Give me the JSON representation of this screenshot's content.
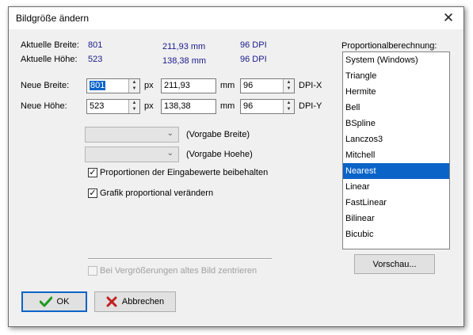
{
  "window": {
    "title": "Bildgröße ändern",
    "close_glyph": "✕"
  },
  "current": {
    "width_label": "Aktuelle Breite:",
    "height_label": "Aktuelle Höhe:",
    "width_px": "801",
    "height_px": "523",
    "width_mm": "211,93 mm",
    "height_mm": "138,38 mm",
    "dpi_x": "96 DPI",
    "dpi_y": "96 DPI"
  },
  "new": {
    "width_label": "Neue Breite:",
    "height_label": "Neue Höhe:",
    "width_px": "801",
    "height_px": "523",
    "px_unit": "px",
    "width_mm": "211,93",
    "height_mm": "138,38",
    "mm_unit": "mm",
    "dpi_x": "96",
    "dpi_y": "96",
    "dpi_x_label": "DPI-X",
    "dpi_y_label": "DPI-Y"
  },
  "presets": {
    "width_value": "",
    "height_value": "",
    "width_label": "(Vorgabe Breite)",
    "height_label": "(Vorgabe Hoehe)"
  },
  "options": {
    "keep_proportions_label": "Proportionen der Eingabewerte beibehalten",
    "keep_proportions_checked": true,
    "scale_graphic_label": "Grafik proportional verändern",
    "scale_graphic_checked": true,
    "center_on_enlarge_label": "Bei Vergrößerungen altes Bild zentrieren",
    "center_on_enlarge_checked": false,
    "center_on_enlarge_enabled": false
  },
  "resampling": {
    "label": "Proportionalberechnung:",
    "items": [
      "System (Windows)",
      "Triangle",
      "Hermite",
      "Bell",
      "BSpline",
      "Lanczos3",
      "Mitchell",
      "Nearest",
      "Linear",
      "FastLinear",
      "Bilinear",
      "Bicubic"
    ],
    "selected": "Nearest"
  },
  "buttons": {
    "preview": "Vorschau...",
    "ok": "OK",
    "cancel": "Abbrechen"
  },
  "colors": {
    "accent": "#0a64c8",
    "ok_icon": "#1e9a1e",
    "cancel_icon": "#c0211f"
  }
}
